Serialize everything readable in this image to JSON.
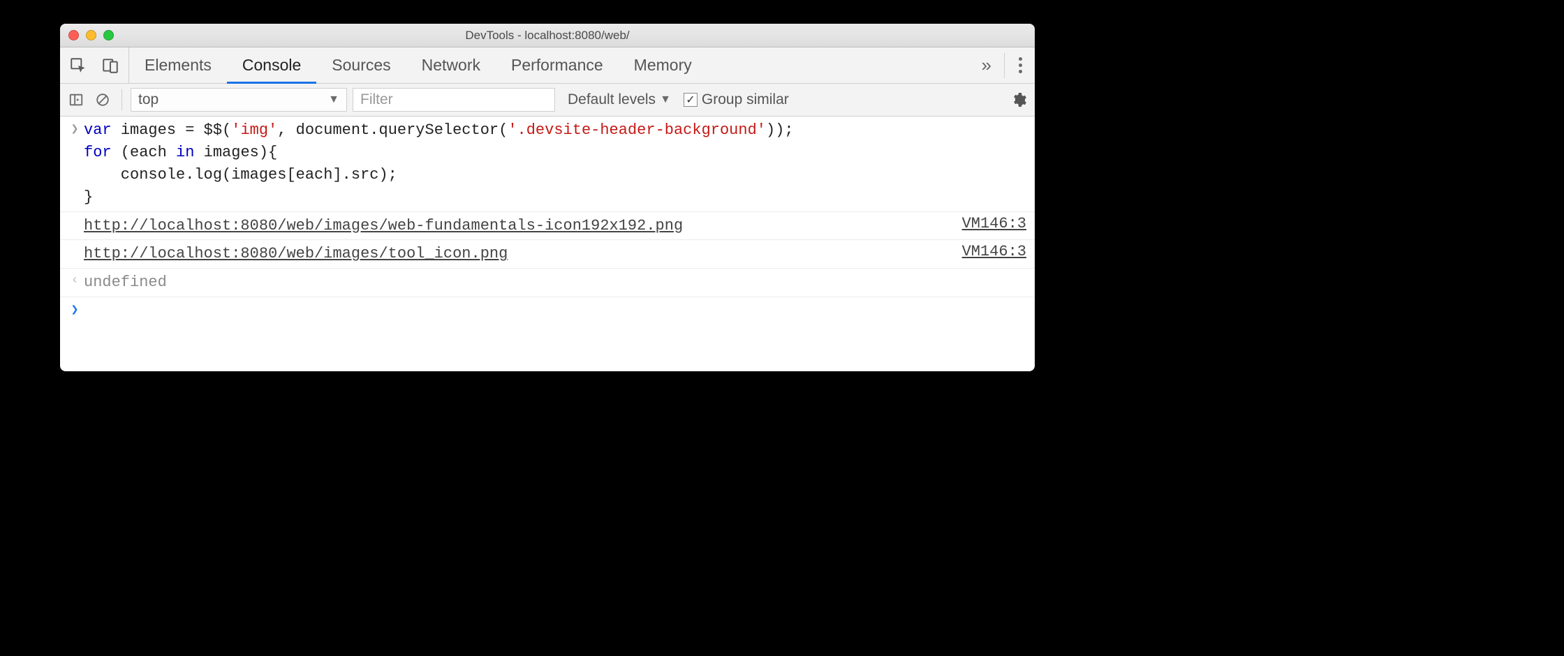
{
  "window": {
    "title": "DevTools - localhost:8080/web/"
  },
  "tabs": [
    "Elements",
    "Console",
    "Sources",
    "Network",
    "Performance",
    "Memory"
  ],
  "toolbar": {
    "context": "top",
    "filter_placeholder": "Filter",
    "levels": "Default levels",
    "group_similar": "Group similar"
  },
  "console": {
    "input_tokens": [
      {
        "t": "var ",
        "c": "kw"
      },
      {
        "t": "images = $$(",
        "c": "fn"
      },
      {
        "t": "'img'",
        "c": "str-red"
      },
      {
        "t": ", document.querySelector(",
        "c": "fn"
      },
      {
        "t": "'.devsite-header-background'",
        "c": "str-red"
      },
      {
        "t": "));",
        "c": "fn"
      },
      {
        "t": "\n",
        "c": ""
      },
      {
        "t": "for",
        "c": "kw"
      },
      {
        "t": " (each ",
        "c": "fn"
      },
      {
        "t": "in",
        "c": "kw"
      },
      {
        "t": " images){",
        "c": "fn"
      },
      {
        "t": "\n",
        "c": ""
      },
      {
        "t": "    console.log(images[each].src);",
        "c": "fn"
      },
      {
        "t": "\n",
        "c": ""
      },
      {
        "t": "}",
        "c": "fn"
      }
    ],
    "logs": [
      {
        "text": "http://localhost:8080/web/images/web-fundamentals-icon192x192.png",
        "source": "VM146:3"
      },
      {
        "text": "http://localhost:8080/web/images/tool_icon.png",
        "source": "VM146:3"
      }
    ],
    "return_value": "undefined"
  }
}
